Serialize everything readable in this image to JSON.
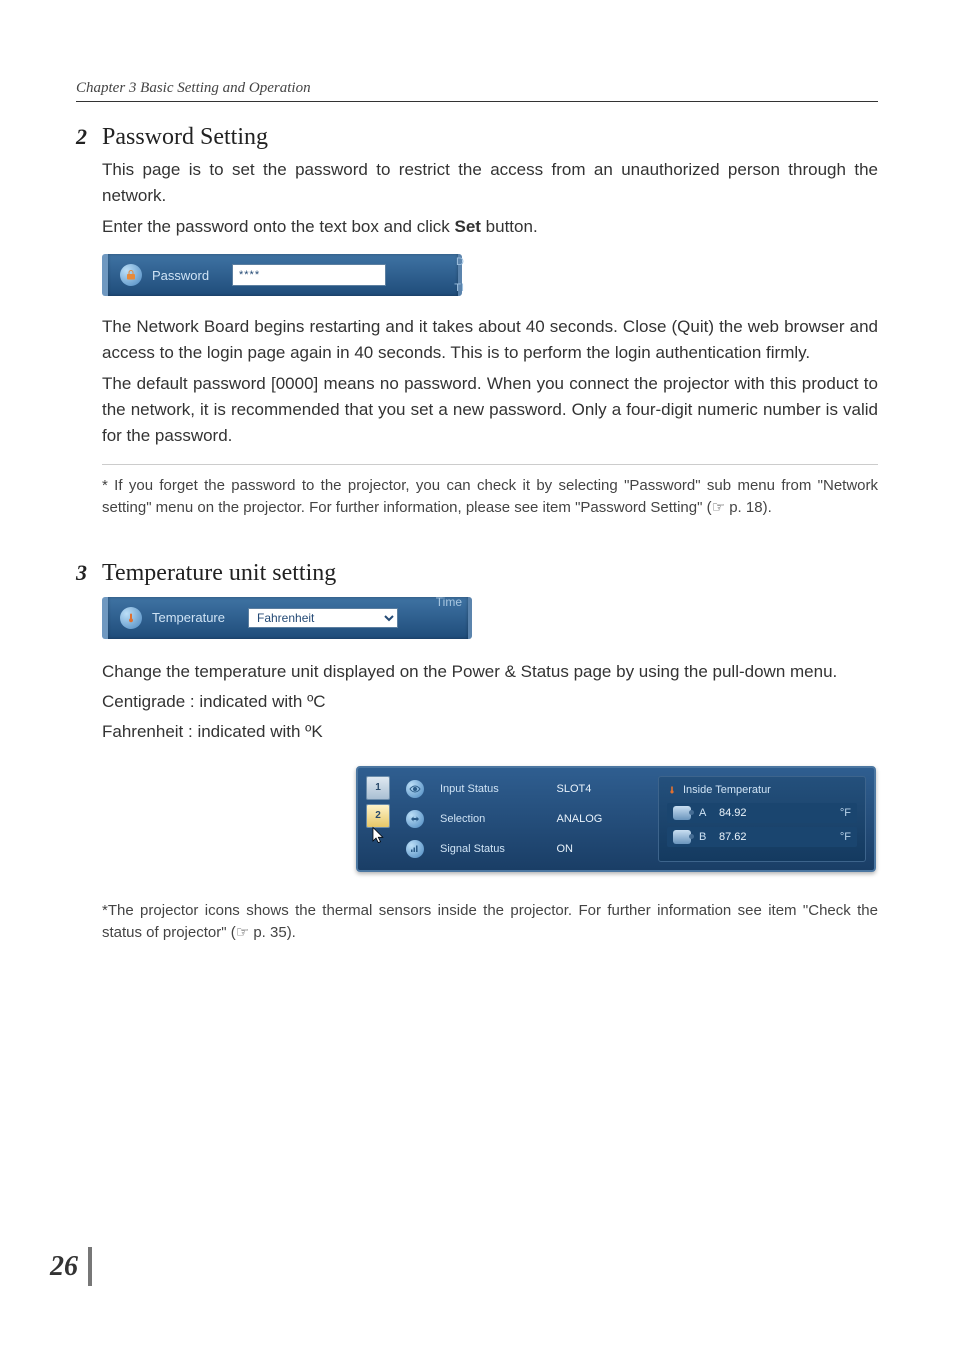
{
  "chapter_header": "Chapter 3 Basic Setting and Operation",
  "section2": {
    "num": "2",
    "title": "Password Setting",
    "para1": "This page is to set the password to restrict the access from an unauthorized person through the network.",
    "para2a": "Enter the password onto the text box and click ",
    "para2_ui": "Set",
    "para2b": " button.",
    "para3": "The Network Board begins restarting and it takes about 40 seconds. Close (Quit) the web browser and access to the login page again in 40 seconds. This is to perform the login authentication firmly.",
    "para4": "The default password [0000] means no password.  When you connect the projector with this product to the network, it is recommended that you set a new password. Only a four-digit numeric number is valid for the password.",
    "footnote": "* If you forget the password to the projector, you can check it by selecting \"Password\" sub menu from \"Network setting\" menu on the projector. For further information, please see item \"Password Setting\" (☞ p. 18)."
  },
  "pw_panel": {
    "label": "Password",
    "value": "****",
    "side_top": "D",
    "side_bot": "TI"
  },
  "section3": {
    "num": "3",
    "title": "Temperature unit setting",
    "para1": "Change the temperature unit displayed on the Power & Status page by using the pull-down  menu.",
    "line_c": "Centigrade : indicated with ºC",
    "line_f": "Fahrenheit : indicated with ºK",
    "footnote": "*The projector icons shows the thermal sensors inside the projector. For further information see item \"Check the status of projector\" (☞ p. 35)."
  },
  "temp_panel": {
    "label": "Temperature",
    "selected": "Fahrenheit",
    "time_label": "Time"
  },
  "status_panel": {
    "tab1": "1",
    "tab2": "2",
    "rows": [
      {
        "label": "Input Status",
        "value": "SLOT4"
      },
      {
        "label": "Selection",
        "value": "ANALOG"
      },
      {
        "label": "Signal Status",
        "value": "ON"
      }
    ],
    "temp_title": "Inside Temperatur",
    "temp_rows": [
      {
        "label": "A",
        "value": "84.92",
        "unit": "°F"
      },
      {
        "label": "B",
        "value": "87.62",
        "unit": "°F"
      }
    ]
  },
  "page_number": "26"
}
